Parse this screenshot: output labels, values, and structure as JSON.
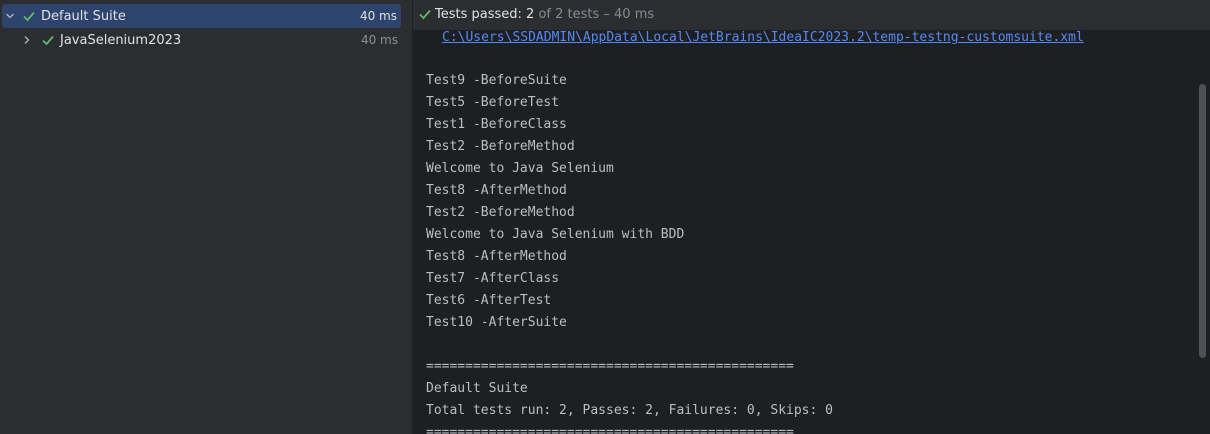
{
  "tree": {
    "root": {
      "label": "Default Suite",
      "time": "40 ms"
    },
    "child": {
      "label": "JavaSelenium2023",
      "time": "40 ms"
    }
  },
  "status": {
    "main": "Tests passed: 2",
    "detail": " of 2 tests – 40 ms"
  },
  "console": {
    "config_path": "C:\\Users\\SSDADMIN\\AppData\\Local\\JetBrains\\IdeaIC2023.2\\temp-testng-customsuite.xml",
    "lines": [
      "Test9 -BeforeSuite",
      "Test5 -BeforeTest",
      "Test1 -BeforeClass",
      "Test2 -BeforeMethod",
      "Welcome to Java Selenium",
      "Test8 -AfterMethod",
      "Test2 -BeforeMethod",
      "Welcome to Java Selenium with BDD",
      "Test8 -AfterMethod",
      "Test7 -AfterClass",
      "Test6 -AfterTest",
      "Test10 -AfterSuite"
    ],
    "separator": "===============================================",
    "suite_name": "Default Suite",
    "summary": "Total tests run: 2, Passes: 2, Failures: 0, Skips: 0",
    "separator_bottom": "==============================================="
  },
  "colors": {
    "pass_green": "#5fb865",
    "selection": "#2e436e",
    "link": "#548af7"
  },
  "icons": {
    "expand": "chevron-down-icon",
    "collapsed": "chevron-right-icon",
    "passed": "check-icon"
  }
}
